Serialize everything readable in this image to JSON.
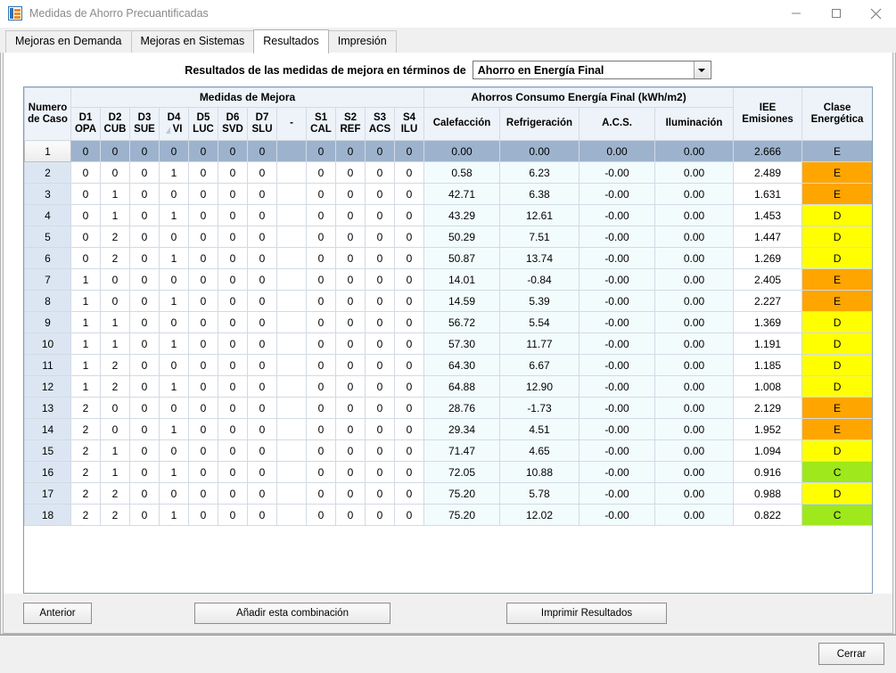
{
  "window": {
    "title": "Medidas de Ahorro Precuantificadas",
    "icon": "app-icon",
    "minimize_label": "minimize-icon",
    "maximize_label": "maximize-icon",
    "close_label": "close-icon"
  },
  "tabs": [
    {
      "label": "Mejoras en Demanda",
      "active": false
    },
    {
      "label": "Mejoras en Sistemas",
      "active": false
    },
    {
      "label": "Resultados",
      "active": true
    },
    {
      "label": "Impresión",
      "active": false
    }
  ],
  "filter": {
    "label": "Resultados de las medidas de mejora en términos de",
    "selected": "Ahorro en Energía Final",
    "options": [
      "Ahorro en Energía Final"
    ]
  },
  "grid": {
    "group_headers": {
      "case": "Numero\nde Caso",
      "case_line1": "Numero",
      "case_line2": "de Caso",
      "improvements": "Medidas de Mejora",
      "savings": "Ahorros Consumo Energía Final (kWh/m2)",
      "iee_line1": "IEE",
      "iee_line2": "Emisiones",
      "class_line1": "Clase",
      "class_line2": "Energética"
    },
    "sub_headers": [
      {
        "code": "D1",
        "name": "OPA",
        "sorted": false
      },
      {
        "code": "D2",
        "name": "CUB",
        "sorted": false
      },
      {
        "code": "D3",
        "name": "SUE",
        "sorted": false
      },
      {
        "code": "D4",
        "name": "VI",
        "sorted": true
      },
      {
        "code": "D5",
        "name": "LUC",
        "sorted": false
      },
      {
        "code": "D6",
        "name": "SVD",
        "sorted": false
      },
      {
        "code": "D7",
        "name": "SLU",
        "sorted": false
      },
      {
        "code": "-",
        "name": "",
        "sorted": false
      },
      {
        "code": "S1",
        "name": "CAL",
        "sorted": false
      },
      {
        "code": "S2",
        "name": "REF",
        "sorted": false
      },
      {
        "code": "S3",
        "name": "ACS",
        "sorted": false
      },
      {
        "code": "S4",
        "name": "ILU",
        "sorted": false
      }
    ],
    "savings_sub_headers": [
      "Calefacción",
      "Refrigeración",
      "A.C.S.",
      "Iluminación"
    ],
    "class_colors": {
      "A": "#00a651",
      "B": "#50b848",
      "C": "#9ee81b",
      "D": "#ffff00",
      "E": "#ffa500",
      "F": "#f47920",
      "G": "#ed1c24"
    },
    "selected_row_index": 0,
    "rows": [
      {
        "case": "1",
        "m": [
          "0",
          "0",
          "0",
          "0",
          "0",
          "0",
          "0",
          "",
          "0",
          "0",
          "0",
          "0"
        ],
        "cal": "0.00",
        "ref": "0.00",
        "acs": "0.00",
        "ilu": "0.00",
        "iee": "2.666",
        "cls": "E",
        "selected": true
      },
      {
        "case": "2",
        "m": [
          "0",
          "0",
          "0",
          "1",
          "0",
          "0",
          "0",
          "",
          "0",
          "0",
          "0",
          "0"
        ],
        "cal": "0.58",
        "ref": "6.23",
        "acs": "-0.00",
        "ilu": "0.00",
        "iee": "2.489",
        "cls": "E",
        "selected": false
      },
      {
        "case": "3",
        "m": [
          "0",
          "1",
          "0",
          "0",
          "0",
          "0",
          "0",
          "",
          "0",
          "0",
          "0",
          "0"
        ],
        "cal": "42.71",
        "ref": "6.38",
        "acs": "-0.00",
        "ilu": "0.00",
        "iee": "1.631",
        "cls": "E",
        "selected": false
      },
      {
        "case": "4",
        "m": [
          "0",
          "1",
          "0",
          "1",
          "0",
          "0",
          "0",
          "",
          "0",
          "0",
          "0",
          "0"
        ],
        "cal": "43.29",
        "ref": "12.61",
        "acs": "-0.00",
        "ilu": "0.00",
        "iee": "1.453",
        "cls": "D",
        "selected": false
      },
      {
        "case": "5",
        "m": [
          "0",
          "2",
          "0",
          "0",
          "0",
          "0",
          "0",
          "",
          "0",
          "0",
          "0",
          "0"
        ],
        "cal": "50.29",
        "ref": "7.51",
        "acs": "-0.00",
        "ilu": "0.00",
        "iee": "1.447",
        "cls": "D",
        "selected": false
      },
      {
        "case": "6",
        "m": [
          "0",
          "2",
          "0",
          "1",
          "0",
          "0",
          "0",
          "",
          "0",
          "0",
          "0",
          "0"
        ],
        "cal": "50.87",
        "ref": "13.74",
        "acs": "-0.00",
        "ilu": "0.00",
        "iee": "1.269",
        "cls": "D",
        "selected": false
      },
      {
        "case": "7",
        "m": [
          "1",
          "0",
          "0",
          "0",
          "0",
          "0",
          "0",
          "",
          "0",
          "0",
          "0",
          "0"
        ],
        "cal": "14.01",
        "ref": "-0.84",
        "acs": "-0.00",
        "ilu": "0.00",
        "iee": "2.405",
        "cls": "E",
        "selected": false
      },
      {
        "case": "8",
        "m": [
          "1",
          "0",
          "0",
          "1",
          "0",
          "0",
          "0",
          "",
          "0",
          "0",
          "0",
          "0"
        ],
        "cal": "14.59",
        "ref": "5.39",
        "acs": "-0.00",
        "ilu": "0.00",
        "iee": "2.227",
        "cls": "E",
        "selected": false
      },
      {
        "case": "9",
        "m": [
          "1",
          "1",
          "0",
          "0",
          "0",
          "0",
          "0",
          "",
          "0",
          "0",
          "0",
          "0"
        ],
        "cal": "56.72",
        "ref": "5.54",
        "acs": "-0.00",
        "ilu": "0.00",
        "iee": "1.369",
        "cls": "D",
        "selected": false
      },
      {
        "case": "10",
        "m": [
          "1",
          "1",
          "0",
          "1",
          "0",
          "0",
          "0",
          "",
          "0",
          "0",
          "0",
          "0"
        ],
        "cal": "57.30",
        "ref": "11.77",
        "acs": "-0.00",
        "ilu": "0.00",
        "iee": "1.191",
        "cls": "D",
        "selected": false
      },
      {
        "case": "11",
        "m": [
          "1",
          "2",
          "0",
          "0",
          "0",
          "0",
          "0",
          "",
          "0",
          "0",
          "0",
          "0"
        ],
        "cal": "64.30",
        "ref": "6.67",
        "acs": "-0.00",
        "ilu": "0.00",
        "iee": "1.185",
        "cls": "D",
        "selected": false
      },
      {
        "case": "12",
        "m": [
          "1",
          "2",
          "0",
          "1",
          "0",
          "0",
          "0",
          "",
          "0",
          "0",
          "0",
          "0"
        ],
        "cal": "64.88",
        "ref": "12.90",
        "acs": "-0.00",
        "ilu": "0.00",
        "iee": "1.008",
        "cls": "D",
        "selected": false
      },
      {
        "case": "13",
        "m": [
          "2",
          "0",
          "0",
          "0",
          "0",
          "0",
          "0",
          "",
          "0",
          "0",
          "0",
          "0"
        ],
        "cal": "28.76",
        "ref": "-1.73",
        "acs": "-0.00",
        "ilu": "0.00",
        "iee": "2.129",
        "cls": "E",
        "selected": false
      },
      {
        "case": "14",
        "m": [
          "2",
          "0",
          "0",
          "1",
          "0",
          "0",
          "0",
          "",
          "0",
          "0",
          "0",
          "0"
        ],
        "cal": "29.34",
        "ref": "4.51",
        "acs": "-0.00",
        "ilu": "0.00",
        "iee": "1.952",
        "cls": "E",
        "selected": false
      },
      {
        "case": "15",
        "m": [
          "2",
          "1",
          "0",
          "0",
          "0",
          "0",
          "0",
          "",
          "0",
          "0",
          "0",
          "0"
        ],
        "cal": "71.47",
        "ref": "4.65",
        "acs": "-0.00",
        "ilu": "0.00",
        "iee": "1.094",
        "cls": "D",
        "selected": false
      },
      {
        "case": "16",
        "m": [
          "2",
          "1",
          "0",
          "1",
          "0",
          "0",
          "0",
          "",
          "0",
          "0",
          "0",
          "0"
        ],
        "cal": "72.05",
        "ref": "10.88",
        "acs": "-0.00",
        "ilu": "0.00",
        "iee": "0.916",
        "cls": "C",
        "selected": false
      },
      {
        "case": "17",
        "m": [
          "2",
          "2",
          "0",
          "0",
          "0",
          "0",
          "0",
          "",
          "0",
          "0",
          "0",
          "0"
        ],
        "cal": "75.20",
        "ref": "5.78",
        "acs": "-0.00",
        "ilu": "0.00",
        "iee": "0.988",
        "cls": "D",
        "selected": false
      },
      {
        "case": "18",
        "m": [
          "2",
          "2",
          "0",
          "1",
          "0",
          "0",
          "0",
          "",
          "0",
          "0",
          "0",
          "0"
        ],
        "cal": "75.20",
        "ref": "12.02",
        "acs": "-0.00",
        "ilu": "0.00",
        "iee": "0.822",
        "cls": "C",
        "selected": false
      }
    ]
  },
  "buttons": {
    "anterior": "Anterior",
    "anadir": "Añadir esta combinación",
    "imprimir": "Imprimir Resultados",
    "cerrar": "Cerrar"
  }
}
